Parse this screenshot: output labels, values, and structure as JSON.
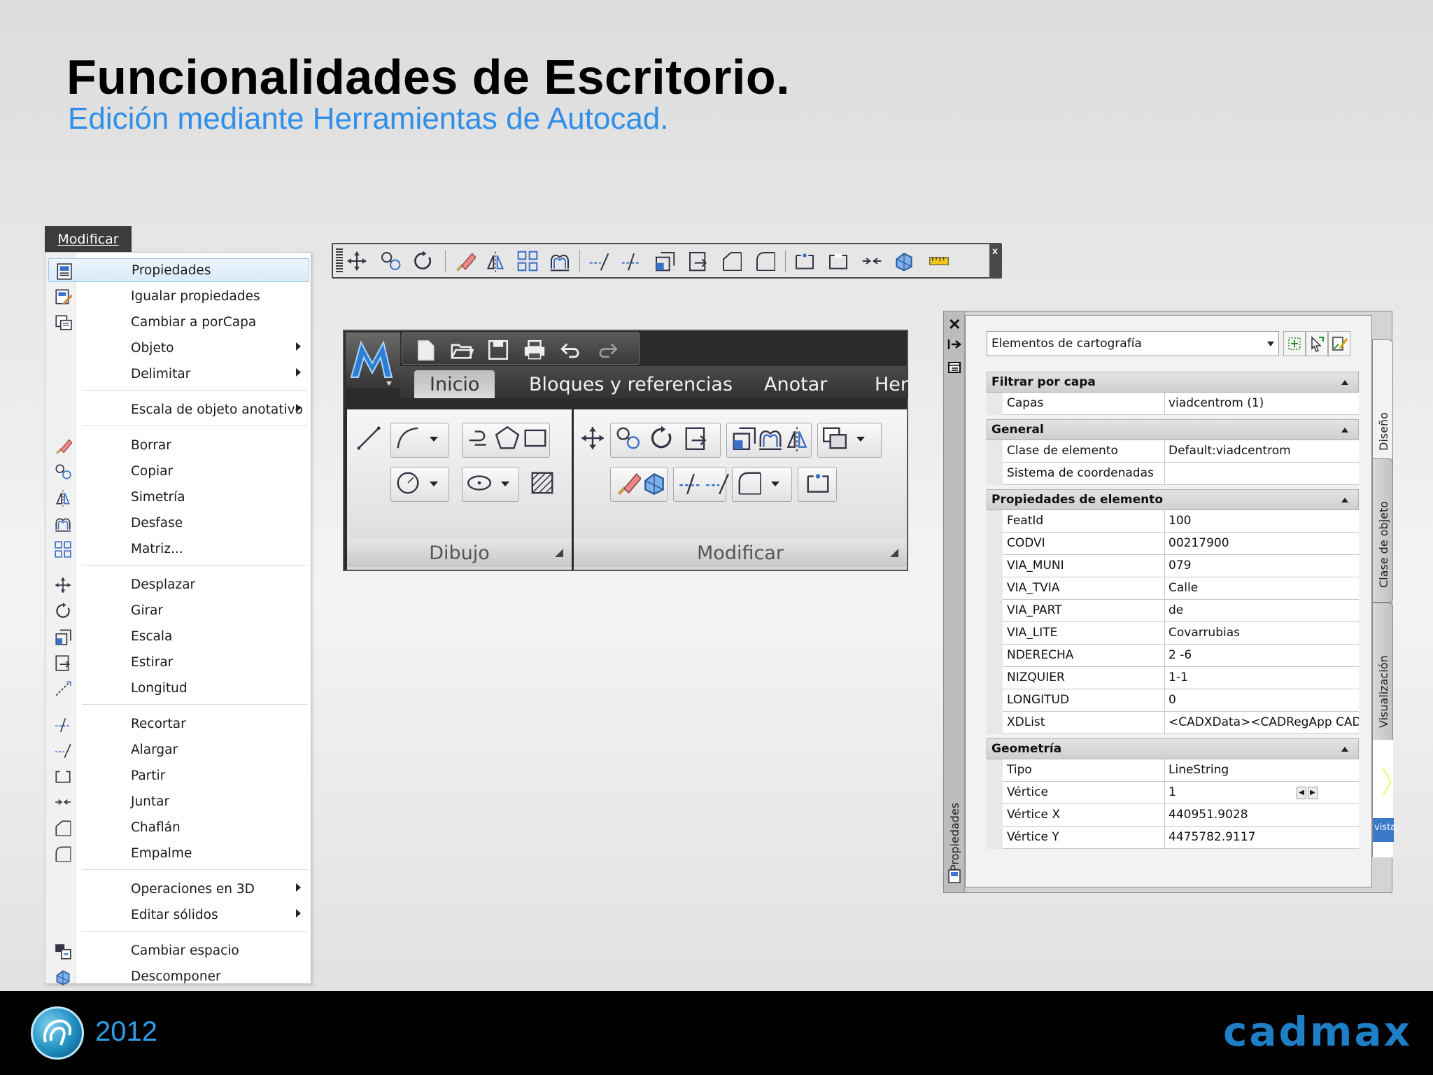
{
  "slide": {
    "title": "Funcionalidades de Escritorio.",
    "subtitle": "Edición mediante Herramientas de Autocad."
  },
  "footer": {
    "year": "2012",
    "brand": "cadmax",
    "colors": {
      "background": "#000000",
      "accent": "#2f9fe8"
    }
  },
  "menu": {
    "title": "Modificar",
    "items": [
      {
        "label": "Propiedades",
        "icon": "properties-icon",
        "selected": true
      },
      {
        "label": "Igualar propiedades",
        "icon": "match-properties-icon"
      },
      {
        "label": "Cambiar a porCapa",
        "icon": "set-bylayer-icon"
      },
      {
        "label": "Objeto",
        "submenu": true
      },
      {
        "label": "Delimitar",
        "submenu": true
      },
      {
        "label": "Escala de objeto anotativo",
        "submenu": true
      },
      {
        "label": "Borrar",
        "icon": "erase-icon"
      },
      {
        "label": "Copiar",
        "icon": "copy-icon"
      },
      {
        "label": "Simetría",
        "icon": "mirror-icon"
      },
      {
        "label": "Desfase",
        "icon": "offset-icon"
      },
      {
        "label": "Matriz...",
        "icon": "array-icon"
      },
      {
        "label": "Desplazar",
        "icon": "move-icon"
      },
      {
        "label": "Girar",
        "icon": "rotate-icon"
      },
      {
        "label": "Escala",
        "icon": "scale-icon"
      },
      {
        "label": "Estirar",
        "icon": "stretch-icon"
      },
      {
        "label": "Longitud",
        "icon": "lengthen-icon"
      },
      {
        "label": "Recortar",
        "icon": "trim-icon"
      },
      {
        "label": "Alargar",
        "icon": "extend-icon"
      },
      {
        "label": "Partir",
        "icon": "break-icon"
      },
      {
        "label": "Juntar",
        "icon": "join-icon"
      },
      {
        "label": "Chaflán",
        "icon": "chamfer-icon"
      },
      {
        "label": "Empalme",
        "icon": "fillet-icon"
      },
      {
        "label": "Operaciones en 3D",
        "submenu": true
      },
      {
        "label": "Editar sólidos",
        "submenu": true
      },
      {
        "label": "Cambiar espacio",
        "icon": "change-space-icon"
      },
      {
        "label": "Descomponer",
        "icon": "explode-icon"
      }
    ]
  },
  "toolbar": {
    "buttons": [
      "move-icon",
      "copy-icon",
      "rotate-icon",
      "erase-icon",
      "mirror-icon",
      "array-icon",
      "offset-icon",
      "extend-icon",
      "trim-icon",
      "scale-icon",
      "stretch-icon",
      "chamfer-icon",
      "fillet-icon",
      "break-at-point-icon",
      "break-icon",
      "join-icon",
      "explode-icon",
      "measure-icon"
    ],
    "close": "x"
  },
  "ribbon": {
    "tabs": [
      "Inicio",
      "Bloques y referencias",
      "Anotar",
      "Her"
    ],
    "active_tab": "Inicio",
    "panels": [
      {
        "label": "Dibujo"
      },
      {
        "label": "Modificar"
      }
    ]
  },
  "palette": {
    "vertical_title": "Propiedades",
    "selector": "Elementos de cartografía",
    "side_tabs": [
      "Diseño",
      "Clase de objeto",
      "Visualización"
    ],
    "fragment_label": "vista",
    "categories": [
      {
        "title": "Filtrar por capa",
        "rows": [
          {
            "name": "Capas",
            "value": "viadcentrom (1)"
          }
        ]
      },
      {
        "title": "General",
        "rows": [
          {
            "name": "Clase de elemento",
            "value": "Default:viadcentrom"
          },
          {
            "name": "Sistema de coordenadas",
            "value": ""
          }
        ]
      },
      {
        "title": "Propiedades de elemento",
        "rows": [
          {
            "name": "FeatId",
            "value": "100"
          },
          {
            "name": "CODVI",
            "value": "00217900"
          },
          {
            "name": "VIA_MUNI",
            "value": "079"
          },
          {
            "name": "VIA_TVIA",
            "value": "Calle"
          },
          {
            "name": "VIA_PART",
            "value": "de"
          },
          {
            "name": "VIA_LITE",
            "value": "Covarrubias"
          },
          {
            "name": "NDERECHA",
            "value": "2 -6"
          },
          {
            "name": "NIZQUIER",
            "value": "1-1"
          },
          {
            "name": "LONGITUD",
            "value": "0"
          },
          {
            "name": "XDList",
            "value": "<CADXData><CADRegApp CAD..."
          }
        ]
      },
      {
        "title": "Geometría",
        "rows": [
          {
            "name": "Tipo",
            "value": "LineString"
          },
          {
            "name": "Vértice",
            "value": "1"
          },
          {
            "name": "Vértice X",
            "value": "440951.9028"
          },
          {
            "name": "Vértice Y",
            "value": "4475782.9117"
          }
        ]
      }
    ]
  }
}
